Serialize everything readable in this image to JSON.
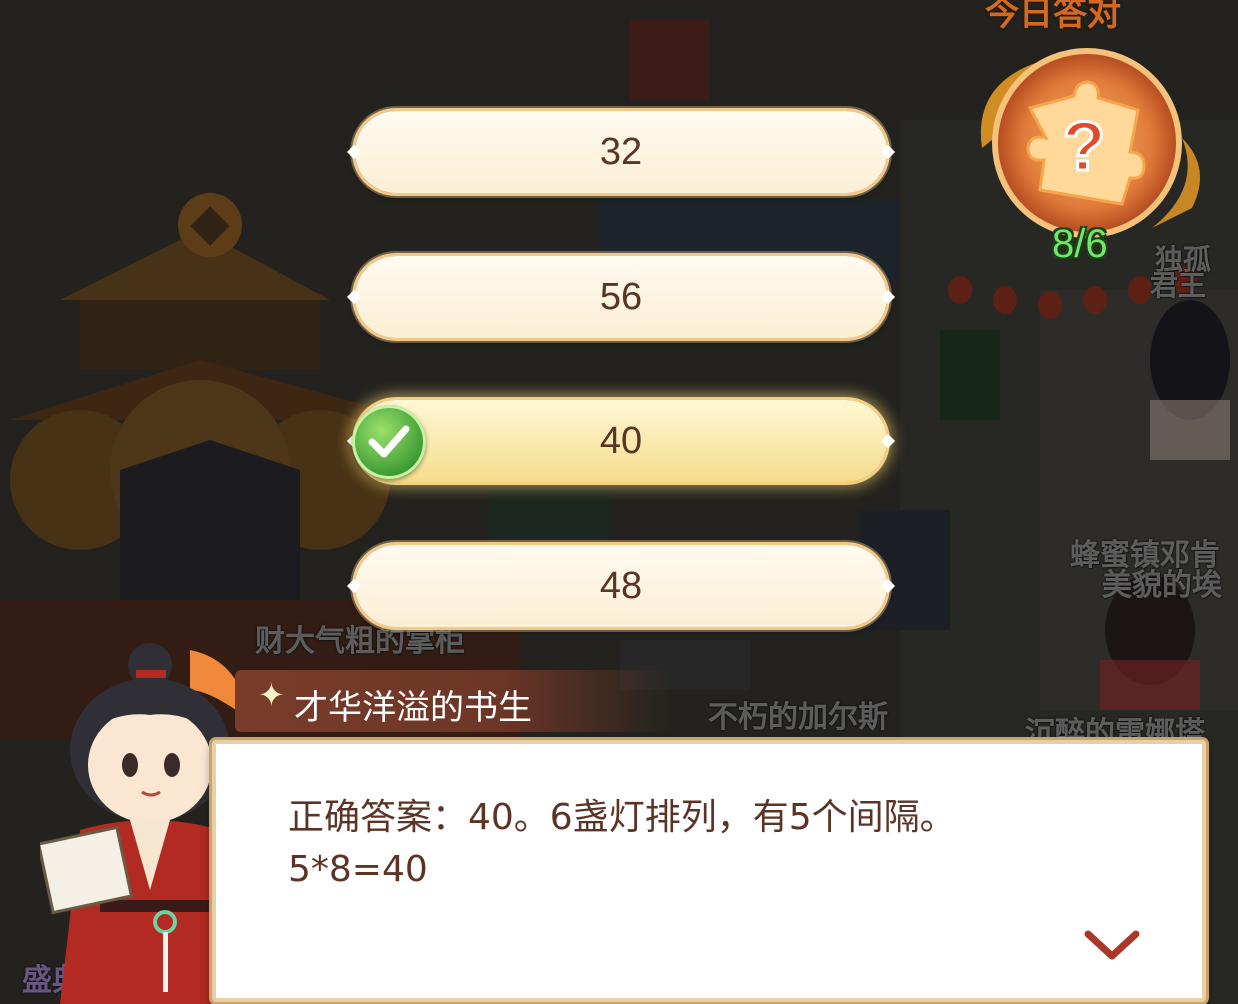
{
  "top_title_partial": "今日答对",
  "progress": {
    "label": "8/6",
    "icon": "puzzle-question-icon"
  },
  "options": [
    {
      "label": "32",
      "correct": false
    },
    {
      "label": "56",
      "correct": false
    },
    {
      "label": "40",
      "correct": true
    },
    {
      "label": "48",
      "correct": false
    }
  ],
  "npc_labels": {
    "shopkeeper": "财大气粗的掌柜",
    "player_a": "不朽的加尔斯",
    "player_b": "沉醉的雷娜塔",
    "player_c_line1": "蜂蜜镇邓肯",
    "player_c_line2": "美貌的埃",
    "player_d_line1": "独孤",
    "player_d_line2": "君王",
    "bottom_left": "盛典"
  },
  "dialog": {
    "speaker": "才华洋溢的书生",
    "line1": "正确答案：40。6盏灯排列，有5个间隔。",
    "line2": "5*8=40"
  },
  "colors": {
    "option_text": "#5a3524",
    "dialog_text": "#5b3426",
    "progress_green": "#6ee86a",
    "check_green": "#3a9a32"
  }
}
